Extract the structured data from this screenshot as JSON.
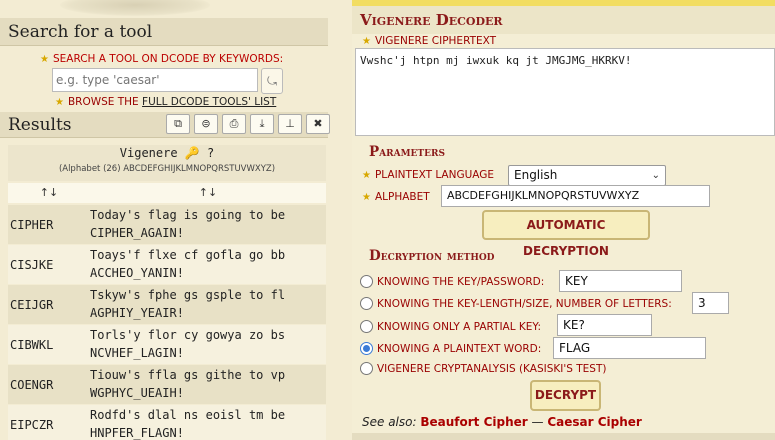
{
  "left": {
    "search_title": "Search for a tool",
    "search_hint": "Search a tool on dCode by keywords:",
    "search_placeholder": "e.g. type 'caesar'",
    "browse_prefix": "Browse the",
    "browse_link": "full dCode tools' list",
    "results_title": "Results",
    "result_buttons": [
      "copy-icon",
      "copy-all-icon",
      "print-icon",
      "download-icon",
      "pin-icon",
      "close-icon"
    ],
    "result_name": "Vigenere",
    "result_icons": "🔑 ?",
    "result_alphabet": "(Alphabet (26) ABCDEFGHIJKLMNOPQRSTUVWXYZ)",
    "sort_col1": "↑↓",
    "sort_col2": "↑↓",
    "rows": [
      {
        "key": "CIPHER",
        "text": "Today's flag is going to be CIPHER_AGAIN!"
      },
      {
        "key": "CISJKE",
        "text": "Toays'f flxe cf gofla go bb ACCHEO_YANIN!"
      },
      {
        "key": "CEIJGR",
        "text": "Tskyw's fphe gs gsple to fl AGPHIY_YEAIR!"
      },
      {
        "key": "CIBWKL",
        "text": "Torls'y flor cy gowya zo bs NCVHEF_LAGIN!"
      },
      {
        "key": "COENGR",
        "text": "Tiouw's ffla gs githe to vp WGPHYC_UEAIH!"
      },
      {
        "key": "EIPCZR",
        "text": "Rodfd's dlal ns eoisl tm be HNPFER_FLAGN!"
      }
    ]
  },
  "right": {
    "tool_title": "Vigenere Decoder",
    "cipher_label": "Vigenere ciphertext",
    "ciphertext": "Vwshc'j htpn mj iwxuk kq jt JMGJMG_HKRKV!",
    "parameters_title": "Parameters",
    "lang_label": "Plaintext language",
    "lang_value": "English",
    "alphabet_label": "Alphabet",
    "alphabet_value": "ABCDEFGHIJKLMNOPQRSTUVWXYZ",
    "auto_button": "AUTOMATIC DECRYPTION",
    "decryption_title": "Decryption method",
    "opt_key": "Knowing the key/password:",
    "opt_key_value": "KEY",
    "opt_len": "Knowing the key-length/size, number of letters:",
    "opt_len_value": "3",
    "opt_partial": "Knowing only a partial key:",
    "opt_partial_value": "KE?",
    "opt_plain": "Knowing a plaintext word:",
    "opt_plain_value": "FLAG",
    "opt_crypt": "Vigenere cryptanalysis (Kasiski's test)",
    "decrypt_button": "DECRYPT",
    "see_also_prefix": "See also:",
    "see_also_1": "Beaufort Cipher",
    "see_also_sep": "—",
    "see_also_2": "Caesar Cipher"
  }
}
